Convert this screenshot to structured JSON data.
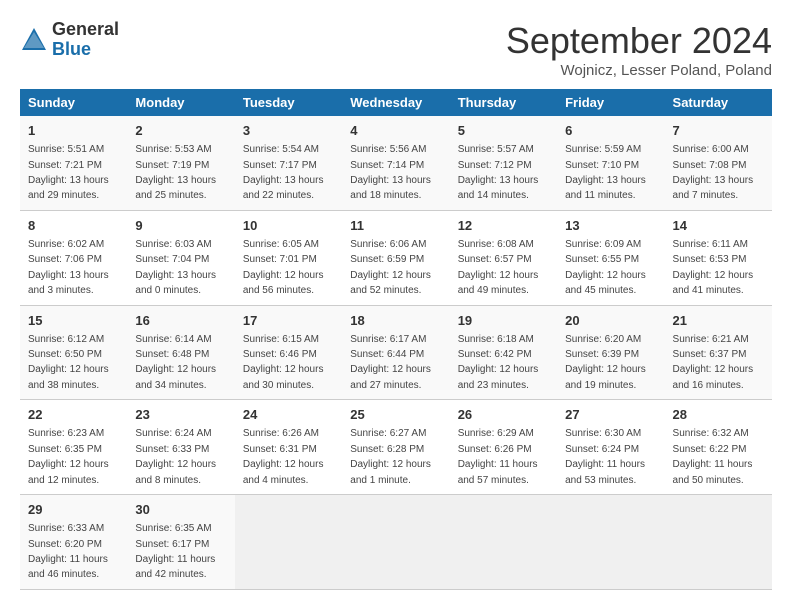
{
  "header": {
    "logo_general": "General",
    "logo_blue": "Blue",
    "month_title": "September 2024",
    "subtitle": "Wojnicz, Lesser Poland, Poland"
  },
  "days_of_week": [
    "Sunday",
    "Monday",
    "Tuesday",
    "Wednesday",
    "Thursday",
    "Friday",
    "Saturday"
  ],
  "weeks": [
    [
      {
        "num": "1",
        "sunrise": "5:51 AM",
        "sunset": "7:21 PM",
        "daylight": "13 hours and 29 minutes."
      },
      {
        "num": "2",
        "sunrise": "5:53 AM",
        "sunset": "7:19 PM",
        "daylight": "13 hours and 25 minutes."
      },
      {
        "num": "3",
        "sunrise": "5:54 AM",
        "sunset": "7:17 PM",
        "daylight": "13 hours and 22 minutes."
      },
      {
        "num": "4",
        "sunrise": "5:56 AM",
        "sunset": "7:14 PM",
        "daylight": "13 hours and 18 minutes."
      },
      {
        "num": "5",
        "sunrise": "5:57 AM",
        "sunset": "7:12 PM",
        "daylight": "13 hours and 14 minutes."
      },
      {
        "num": "6",
        "sunrise": "5:59 AM",
        "sunset": "7:10 PM",
        "daylight": "13 hours and 11 minutes."
      },
      {
        "num": "7",
        "sunrise": "6:00 AM",
        "sunset": "7:08 PM",
        "daylight": "13 hours and 7 minutes."
      }
    ],
    [
      {
        "num": "8",
        "sunrise": "6:02 AM",
        "sunset": "7:06 PM",
        "daylight": "13 hours and 3 minutes."
      },
      {
        "num": "9",
        "sunrise": "6:03 AM",
        "sunset": "7:04 PM",
        "daylight": "13 hours and 0 minutes."
      },
      {
        "num": "10",
        "sunrise": "6:05 AM",
        "sunset": "7:01 PM",
        "daylight": "12 hours and 56 minutes."
      },
      {
        "num": "11",
        "sunrise": "6:06 AM",
        "sunset": "6:59 PM",
        "daylight": "12 hours and 52 minutes."
      },
      {
        "num": "12",
        "sunrise": "6:08 AM",
        "sunset": "6:57 PM",
        "daylight": "12 hours and 49 minutes."
      },
      {
        "num": "13",
        "sunrise": "6:09 AM",
        "sunset": "6:55 PM",
        "daylight": "12 hours and 45 minutes."
      },
      {
        "num": "14",
        "sunrise": "6:11 AM",
        "sunset": "6:53 PM",
        "daylight": "12 hours and 41 minutes."
      }
    ],
    [
      {
        "num": "15",
        "sunrise": "6:12 AM",
        "sunset": "6:50 PM",
        "daylight": "12 hours and 38 minutes."
      },
      {
        "num": "16",
        "sunrise": "6:14 AM",
        "sunset": "6:48 PM",
        "daylight": "12 hours and 34 minutes."
      },
      {
        "num": "17",
        "sunrise": "6:15 AM",
        "sunset": "6:46 PM",
        "daylight": "12 hours and 30 minutes."
      },
      {
        "num": "18",
        "sunrise": "6:17 AM",
        "sunset": "6:44 PM",
        "daylight": "12 hours and 27 minutes."
      },
      {
        "num": "19",
        "sunrise": "6:18 AM",
        "sunset": "6:42 PM",
        "daylight": "12 hours and 23 minutes."
      },
      {
        "num": "20",
        "sunrise": "6:20 AM",
        "sunset": "6:39 PM",
        "daylight": "12 hours and 19 minutes."
      },
      {
        "num": "21",
        "sunrise": "6:21 AM",
        "sunset": "6:37 PM",
        "daylight": "12 hours and 16 minutes."
      }
    ],
    [
      {
        "num": "22",
        "sunrise": "6:23 AM",
        "sunset": "6:35 PM",
        "daylight": "12 hours and 12 minutes."
      },
      {
        "num": "23",
        "sunrise": "6:24 AM",
        "sunset": "6:33 PM",
        "daylight": "12 hours and 8 minutes."
      },
      {
        "num": "24",
        "sunrise": "6:26 AM",
        "sunset": "6:31 PM",
        "daylight": "12 hours and 4 minutes."
      },
      {
        "num": "25",
        "sunrise": "6:27 AM",
        "sunset": "6:28 PM",
        "daylight": "12 hours and 1 minute."
      },
      {
        "num": "26",
        "sunrise": "6:29 AM",
        "sunset": "6:26 PM",
        "daylight": "11 hours and 57 minutes."
      },
      {
        "num": "27",
        "sunrise": "6:30 AM",
        "sunset": "6:24 PM",
        "daylight": "11 hours and 53 minutes."
      },
      {
        "num": "28",
        "sunrise": "6:32 AM",
        "sunset": "6:22 PM",
        "daylight": "11 hours and 50 minutes."
      }
    ],
    [
      {
        "num": "29",
        "sunrise": "6:33 AM",
        "sunset": "6:20 PM",
        "daylight": "11 hours and 46 minutes."
      },
      {
        "num": "30",
        "sunrise": "6:35 AM",
        "sunset": "6:17 PM",
        "daylight": "11 hours and 42 minutes."
      },
      null,
      null,
      null,
      null,
      null
    ]
  ]
}
